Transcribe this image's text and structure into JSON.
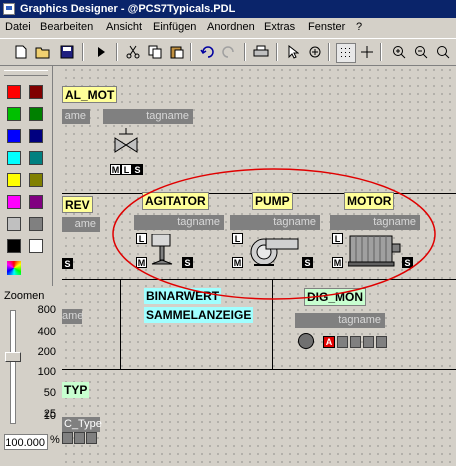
{
  "window": {
    "title": "Graphics Designer - @PCS7Typicals.PDL"
  },
  "menu": [
    "Datei",
    "Bearbeiten",
    "Ansicht",
    "Einfügen",
    "Anordnen",
    "Extras",
    "Fenster",
    "?"
  ],
  "palette": {
    "colors": [
      "#ff0000",
      "#800000",
      "#00c000",
      "#008000",
      "#0000ff",
      "#000080",
      "#00ffff",
      "#008080",
      "#ffff00",
      "#808000",
      "#ff00ff",
      "#800080",
      "#c0c0c0",
      "#808080",
      "#000000",
      "#ffffff"
    ]
  },
  "zoom": {
    "label": "Zoomen",
    "scale": [
      "800",
      "400",
      "200",
      "100",
      "50",
      "25",
      "10"
    ],
    "value": "100.000",
    "unit": "%"
  },
  "canvas": {
    "al_mot": "AL_MOT",
    "rev": "REV",
    "typ": "TYP",
    "c_type": "C_Type",
    "tag": "tagname",
    "tag_partial": "ame",
    "agitator": "AGITATOR",
    "pump": "PUMP",
    "motor": "MOTOR",
    "binarwert": "BINARWERT",
    "sammelanzeige": "SAMMELANZEIGE",
    "dig_mon": "DIG_MON",
    "letters": {
      "m": "M",
      "l": "L",
      "s": "S",
      "a": "A"
    }
  }
}
